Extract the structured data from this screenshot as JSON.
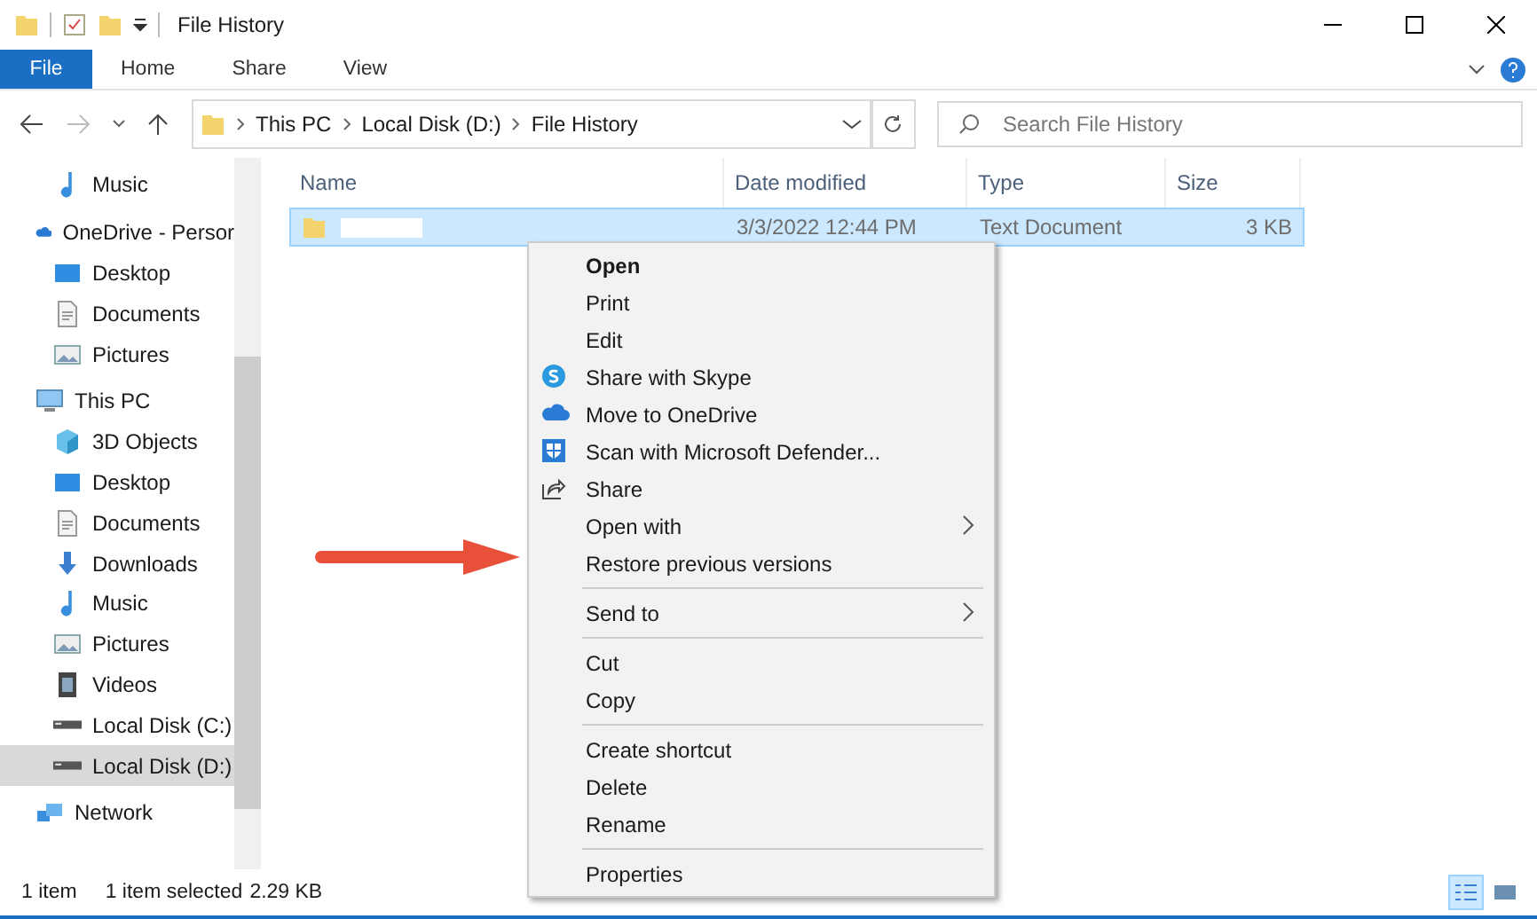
{
  "window": {
    "title": "File History"
  },
  "ribbon_tabs": [
    {
      "label": "File",
      "selected": true
    },
    {
      "label": "Home",
      "selected": false
    },
    {
      "label": "Share",
      "selected": false
    },
    {
      "label": "View",
      "selected": false
    }
  ],
  "address": {
    "path": [
      "This PC",
      "Local Disk (D:)",
      "File History"
    ]
  },
  "search": {
    "placeholder": "Search File History"
  },
  "sidebar": {
    "items": [
      {
        "children": [
          {
            "label": "Music",
            "kind": "music",
            "selected": false
          }
        ]
      },
      {
        "label": "OneDrive - Persor",
        "kind": "cloud",
        "selected": false,
        "children": [
          {
            "label": "Desktop",
            "kind": "desktop",
            "selected": false
          },
          {
            "label": "Documents",
            "kind": "document",
            "selected": false
          },
          {
            "label": "Pictures",
            "kind": "picture",
            "selected": false
          }
        ]
      },
      {
        "label": "This PC",
        "kind": "pc",
        "selected": false,
        "children": [
          {
            "label": "3D Objects",
            "kind": "cube",
            "selected": false
          },
          {
            "label": "Desktop",
            "kind": "desktop",
            "selected": false
          },
          {
            "label": "Documents",
            "kind": "document",
            "selected": false
          },
          {
            "label": "Downloads",
            "kind": "download",
            "selected": false
          },
          {
            "label": "Music",
            "kind": "music",
            "selected": false
          },
          {
            "label": "Pictures",
            "kind": "picture",
            "selected": false
          },
          {
            "label": "Videos",
            "kind": "video",
            "selected": false
          },
          {
            "label": "Local Disk (C:)",
            "kind": "disk",
            "selected": false
          },
          {
            "label": "Local Disk (D:)",
            "kind": "disk",
            "selected": true
          }
        ]
      },
      {
        "label": "Network",
        "kind": "network",
        "selected": false
      }
    ]
  },
  "table": {
    "columns": [
      "Name",
      "Date modified",
      "Type",
      "Size"
    ],
    "rows": [
      {
        "date": "3/3/2022 12:44 PM",
        "type": "Text Document",
        "size": "3 KB",
        "selected": true
      }
    ]
  },
  "context_menu": {
    "items": [
      {
        "kind": "default",
        "label": "Open"
      },
      {
        "kind": "plain",
        "label": "Print"
      },
      {
        "kind": "plain",
        "label": "Edit"
      },
      {
        "kind": "skype",
        "label": "Share with Skype"
      },
      {
        "kind": "onedrive",
        "label": "Move to OneDrive"
      },
      {
        "kind": "defender",
        "label": "Scan with Microsoft Defender..."
      },
      {
        "kind": "share",
        "label": "Share"
      },
      {
        "kind": "submenu",
        "label": "Open with"
      },
      {
        "kind": "plain",
        "label": "Restore previous versions"
      },
      {
        "kind": "separator"
      },
      {
        "kind": "submenu",
        "label": "Send to"
      },
      {
        "kind": "separator"
      },
      {
        "kind": "plain",
        "label": "Cut"
      },
      {
        "kind": "plain",
        "label": "Copy"
      },
      {
        "kind": "separator"
      },
      {
        "kind": "plain",
        "label": "Create shortcut"
      },
      {
        "kind": "plain",
        "label": "Delete"
      },
      {
        "kind": "plain",
        "label": "Rename"
      },
      {
        "kind": "separator"
      },
      {
        "kind": "plain",
        "label": "Properties"
      }
    ]
  },
  "status_bar": {
    "item_count": "1 item",
    "selection": "1 item selected",
    "selection_size": "2.29 KB"
  }
}
